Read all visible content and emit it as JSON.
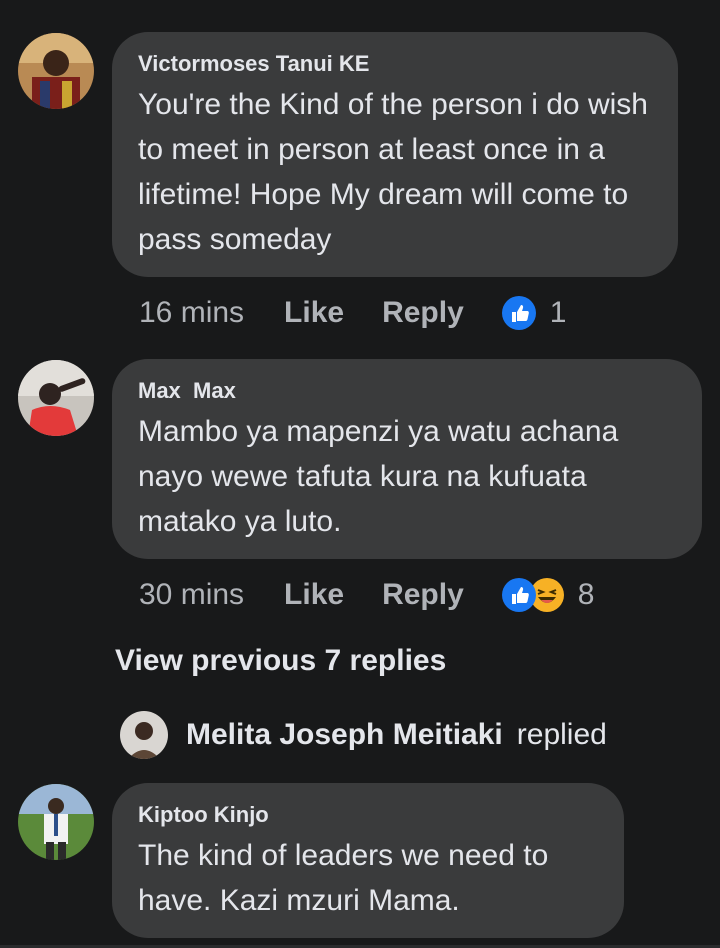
{
  "comments": [
    {
      "author": "Victormoses Tanui KE",
      "text": "You're the Kind of the person i do wish to meet in person at least once in a lifetime! Hope My dream will come to pass someday",
      "time": "16 mins",
      "like_label": "Like",
      "reply_label": "Reply",
      "reactions": [
        "like-icon"
      ],
      "reaction_count": "1"
    },
    {
      "author": "Max  Max",
      "text": "Mambo ya mapenzi ya watu achana nayo wewe tafuta kura na kufuata matako ya luto.",
      "time": "30 mins",
      "like_label": "Like",
      "reply_label": "Reply",
      "reactions": [
        "like-icon",
        "haha-icon"
      ],
      "reaction_count": "8"
    },
    {
      "author": "Kiptoo Kinjo",
      "text": "The kind of leaders we need to have.  Kazi mzuri Mama."
    }
  ],
  "view_previous": "View previous 7 replies",
  "reply_preview": {
    "name": "Melita Joseph Meitiaki",
    "verb": "replied"
  },
  "colors": {
    "background": "#18191a",
    "bubble": "#3a3b3c",
    "text": "#e4e6eb",
    "secondary": "#b0b3b8",
    "like_blue": "#1877f2",
    "haha_yellow": "#f7b125"
  }
}
